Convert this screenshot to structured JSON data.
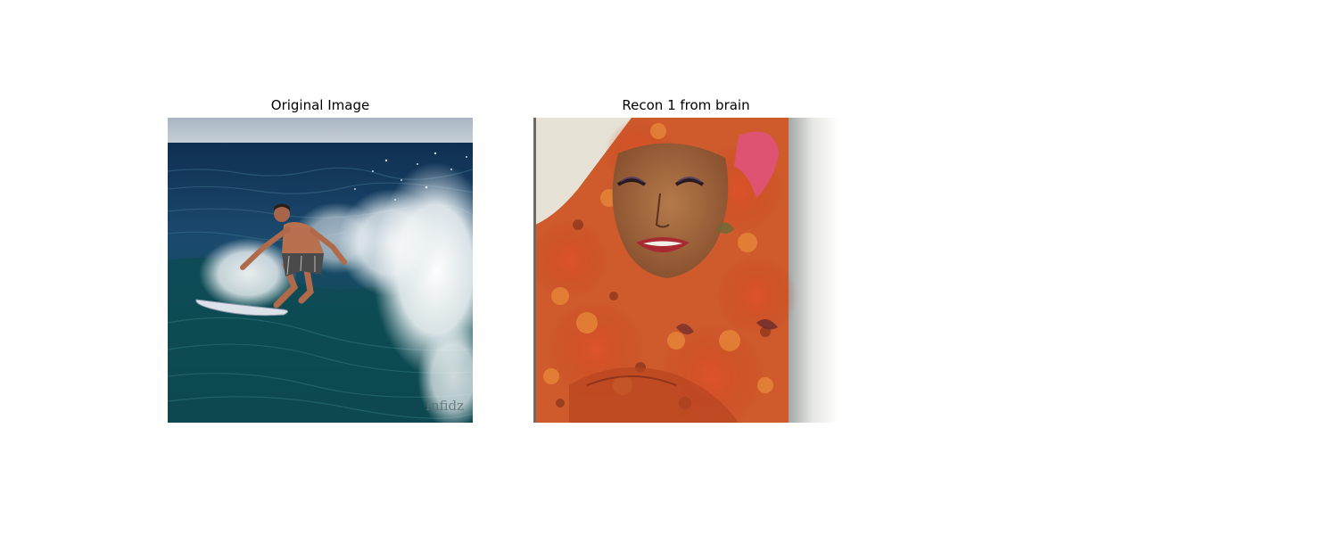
{
  "panels": [
    {
      "title": "Original Image"
    },
    {
      "title": "Recon 1 from brain"
    }
  ],
  "watermark": "Infidz"
}
